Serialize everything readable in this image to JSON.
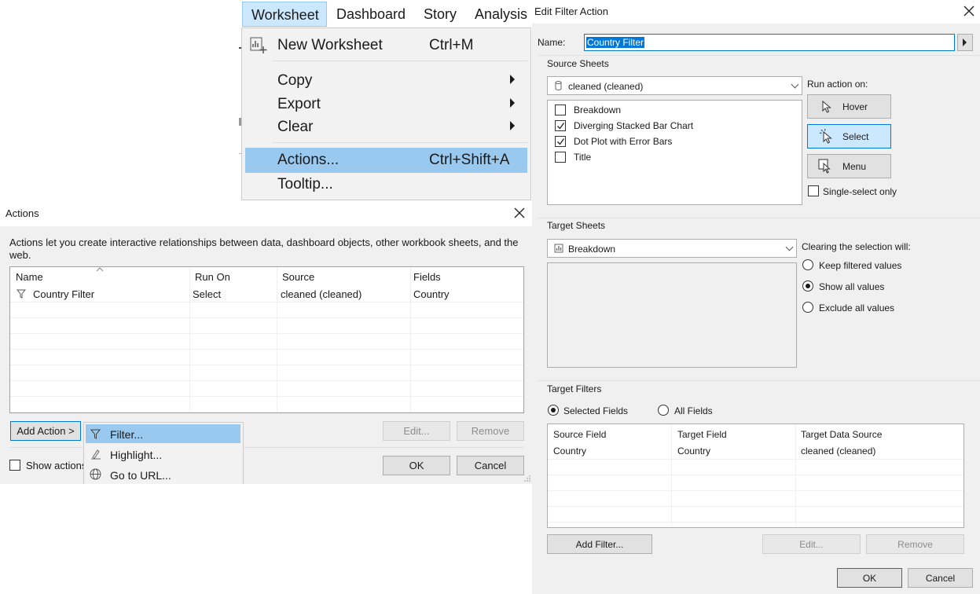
{
  "menubar": {
    "items": [
      "Worksheet",
      "Dashboard",
      "Story",
      "Analysis"
    ]
  },
  "worksheet_menu": {
    "new_worksheet": "New Worksheet",
    "new_worksheet_shortcut": "Ctrl+M",
    "copy": "Copy",
    "export": "Export",
    "clear": "Clear",
    "actions": "Actions...",
    "actions_shortcut": "Ctrl+Shift+A",
    "tooltip": "Tooltip..."
  },
  "actions_dialog": {
    "title": "Actions",
    "description": "Actions let you create interactive relationships between data, dashboard objects, other workbook sheets, and the web.",
    "columns": [
      "Name",
      "Run On",
      "Source",
      "Fields"
    ],
    "rows": [
      {
        "name": "Country Filter",
        "run_on": "Select",
        "source": "cleaned (cleaned)",
        "fields": "Country"
      }
    ],
    "add_action": "Add Action >",
    "edit": "Edit...",
    "remove": "Remove",
    "show_actions": "Show actions",
    "ok": "OK",
    "cancel": "Cancel"
  },
  "add_action_menu": {
    "filter": "Filter...",
    "highlight": "Highlight...",
    "go_to_url": "Go to URL..."
  },
  "edit_filter_action": {
    "title": "Edit Filter Action",
    "name_label": "Name:",
    "name_value": "Country Filter",
    "source_sheets_label": "Source Sheets",
    "source_datasource": "cleaned (cleaned)",
    "source_sheets": [
      {
        "label": "Breakdown",
        "checked": false
      },
      {
        "label": "Diverging Stacked Bar Chart",
        "checked": true
      },
      {
        "label": "Dot Plot with Error Bars",
        "checked": true
      },
      {
        "label": "Title",
        "checked": false
      }
    ],
    "run_action_on_label": "Run action on:",
    "hover": "Hover",
    "select": "Select",
    "menu": "Menu",
    "single_select_only": "Single-select only",
    "target_sheets_label": "Target Sheets",
    "target_sheet": "Breakdown",
    "clearing_label": "Clearing the selection will:",
    "clearing_options": [
      "Keep filtered values",
      "Show all values",
      "Exclude all values"
    ],
    "clearing_selected": "Show all values",
    "target_filters_label": "Target Filters",
    "selected_fields": "Selected Fields",
    "all_fields": "All Fields",
    "filter_columns": [
      "Source Field",
      "Target Field",
      "Target Data Source"
    ],
    "filter_rows": [
      {
        "source_field": "Country",
        "target_field": "Country",
        "target_data_source": "cleaned (cleaned)"
      }
    ],
    "add_filter": "Add Filter...",
    "edit": "Edit...",
    "remove": "Remove",
    "ok": "OK",
    "cancel": "Cancel"
  },
  "colors": {
    "highlight": "#99c9ef",
    "selected_button": "#cce8ff",
    "dialog_bg": "#f0f0f0",
    "accent": "#0078d7"
  }
}
